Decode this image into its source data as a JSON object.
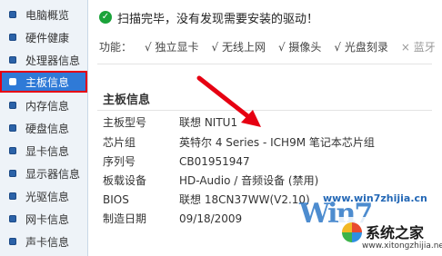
{
  "sidebar": {
    "items": [
      {
        "label": "电脑概览",
        "selected": false
      },
      {
        "label": "硬件健康",
        "selected": false
      },
      {
        "label": "处理器信息",
        "selected": false
      },
      {
        "label": "主板信息",
        "selected": true
      },
      {
        "label": "内存信息",
        "selected": false
      },
      {
        "label": "硬盘信息",
        "selected": false
      },
      {
        "label": "显卡信息",
        "selected": false
      },
      {
        "label": "显示器信息",
        "selected": false
      },
      {
        "label": "光驱信息",
        "selected": false
      },
      {
        "label": "网卡信息",
        "selected": false
      },
      {
        "label": "声卡信息",
        "selected": false
      }
    ]
  },
  "status": {
    "icon": "check-circle-icon",
    "text": "扫描完毕，没有发现需要安装的驱动！"
  },
  "features": {
    "label": "功能：",
    "items": [
      {
        "text": "√ 独立显卡",
        "enabled": true
      },
      {
        "text": "√ 无线上网",
        "enabled": true
      },
      {
        "text": "√ 摄像头",
        "enabled": true
      },
      {
        "text": "√ 光盘刻录",
        "enabled": true
      },
      {
        "text": "× 蓝牙",
        "enabled": false
      }
    ]
  },
  "section": {
    "title": "主板信息",
    "rows": [
      {
        "key": "主板型号",
        "value": "联想 NITU1"
      },
      {
        "key": "芯片组",
        "value": "英特尔 4 Series - ICH9M 笔记本芯片组"
      },
      {
        "key": "序列号",
        "value": "CB01951947"
      },
      {
        "key": "板载设备",
        "value": "HD-Audio / 音频设备 (禁用)"
      },
      {
        "key": "BIOS",
        "value": "联想 18CN37WW(V2.10)"
      },
      {
        "key": "制造日期",
        "value": "09/18/2009"
      }
    ]
  },
  "watermark": {
    "url": "www.win7zhijia.cn",
    "logo_text": "Win7",
    "site_name": "系统之家",
    "site_url": "www.xitongzhijia.net"
  },
  "colors": {
    "accent": "#2f7ad7",
    "highlight": "#e60012",
    "arrow": "#e60012"
  }
}
